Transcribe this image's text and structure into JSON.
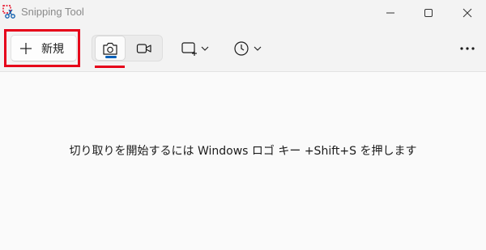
{
  "window": {
    "title": "Snipping Tool"
  },
  "toolbar": {
    "new_label": "新規",
    "modes": [
      {
        "name": "camera-icon",
        "selected": true
      },
      {
        "name": "video-camera-icon",
        "selected": false
      }
    ],
    "shape_icon": "rectangle-snip-icon",
    "timer_icon": "clock-icon",
    "more_icon": "ellipsis-icon"
  },
  "main": {
    "hint": "切り取りを開始するには Windows ロゴ キー +Shift+S を押します"
  },
  "colors": {
    "highlight": "#e6001a",
    "accent": "#005fb8",
    "background": "#f3f3f3"
  }
}
